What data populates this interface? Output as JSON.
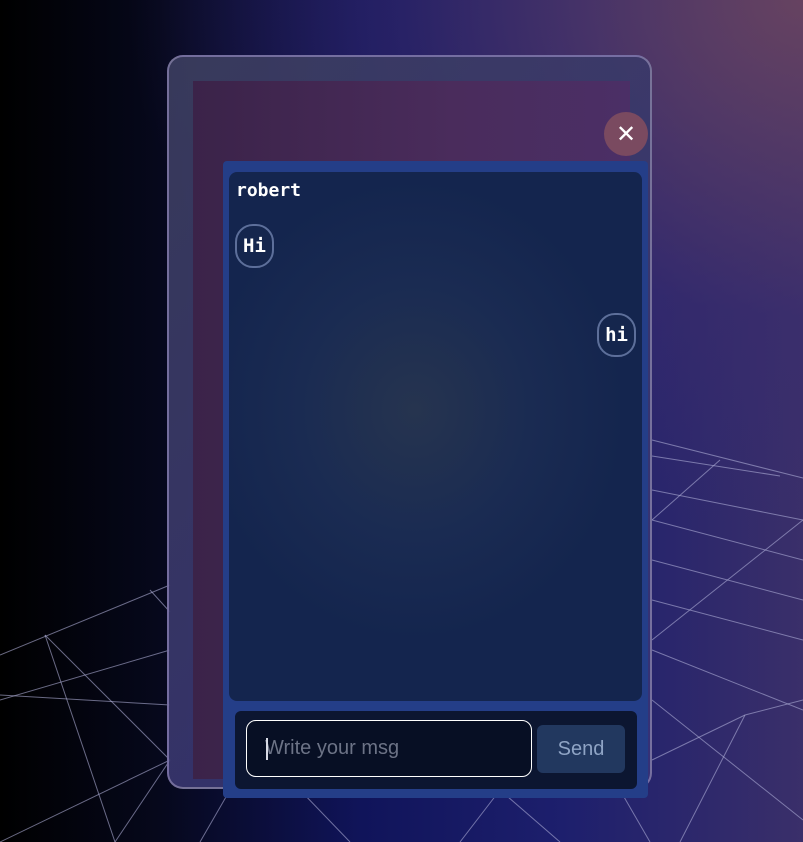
{
  "window": {
    "close_icon": "close-icon",
    "close_glyph": "✕"
  },
  "chat": {
    "username": "robert",
    "messages": [
      {
        "text": "Hi",
        "direction": "incoming"
      },
      {
        "text": "hi",
        "direction": "outgoing"
      }
    ]
  },
  "composer": {
    "input_value": "",
    "input_placeholder": "Write your msg",
    "send_label": "Send"
  },
  "colors": {
    "panel": "#243e88",
    "close_button": "#7a4a60",
    "send_button": "#22385f"
  }
}
